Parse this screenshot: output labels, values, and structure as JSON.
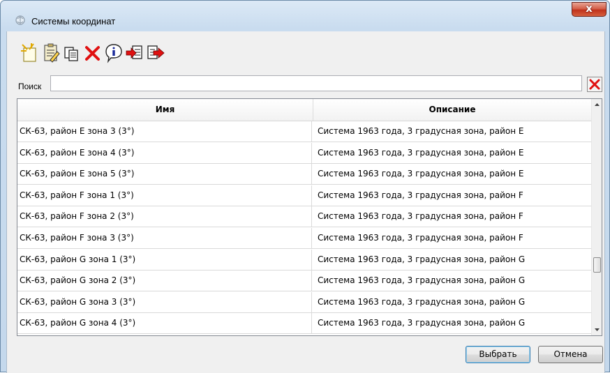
{
  "window": {
    "title": "Системы координат",
    "close_glyph": "x"
  },
  "toolbar": [
    {
      "name": "new-icon",
      "tooltip": ""
    },
    {
      "name": "edit-icon",
      "tooltip": ""
    },
    {
      "name": "copy-icon",
      "tooltip": ""
    },
    {
      "name": "delete-icon",
      "tooltip": ""
    },
    {
      "name": "info-icon",
      "tooltip": ""
    },
    {
      "name": "import-icon",
      "tooltip": ""
    },
    {
      "name": "export-icon",
      "tooltip": ""
    }
  ],
  "search": {
    "label": "Поиск",
    "value": "",
    "placeholder": ""
  },
  "grid": {
    "columns": [
      "Имя",
      "Описание"
    ],
    "rows": [
      [
        "СК-63, район E зона 3 (3°)",
        "Система 1963 года, 3 градусная зона, район E"
      ],
      [
        "СК-63, район E зона 4 (3°)",
        "Система 1963 года, 3 градусная зона, район E"
      ],
      [
        "СК-63, район E зона 5 (3°)",
        "Система 1963 года, 3 градусная зона, район E"
      ],
      [
        "СК-63, район F зона 1 (3°)",
        "Система 1963 года, 3 градусная зона, район F"
      ],
      [
        "СК-63, район F зона 2 (3°)",
        "Система 1963 года, 3 градусная зона, район F"
      ],
      [
        "СК-63, район F зона 3 (3°)",
        "Система 1963 года, 3 градусная зона, район F"
      ],
      [
        "СК-63, район G зона 1 (3°)",
        "Система 1963 года, 3 градусная зона, район G"
      ],
      [
        "СК-63, район G зона 2 (3°)",
        "Система 1963 года, 3 градусная зона, район G"
      ],
      [
        "СК-63, район G зона 3 (3°)",
        "Система 1963 года, 3 градусная зона, район G"
      ],
      [
        "СК-63, район G зона 4 (3°)",
        "Система 1963 года, 3 градусная зона, район G"
      ]
    ]
  },
  "buttons": {
    "select": "Выбрать",
    "cancel": "Отмена"
  },
  "colors": {
    "delete_red": "#e01010",
    "accent_blue": "#3c7fb1",
    "close_red": "#c0321c"
  }
}
